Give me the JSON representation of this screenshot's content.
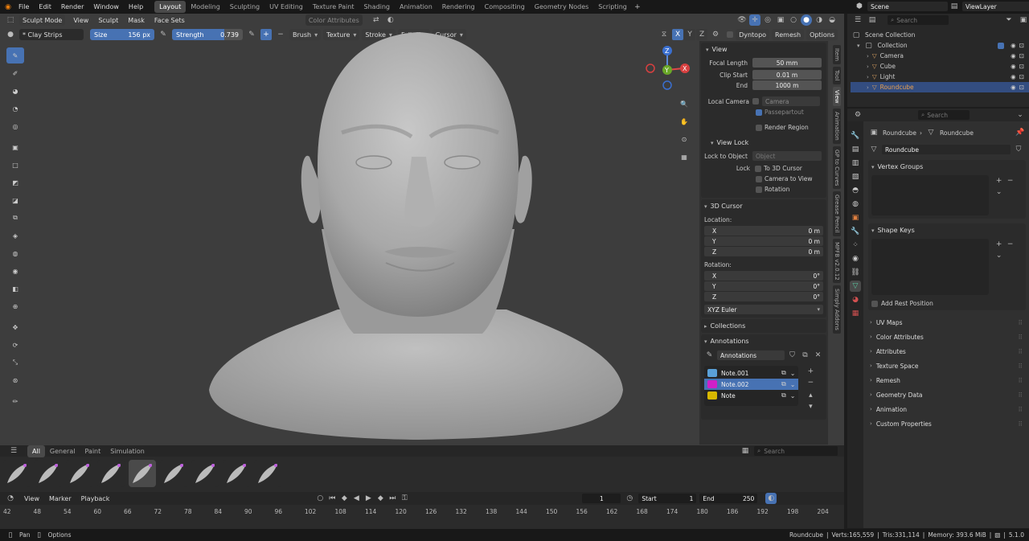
{
  "topbar": {
    "menus": [
      "File",
      "Edit",
      "Render",
      "Window",
      "Help"
    ],
    "workspaces": [
      "Layout",
      "Modeling",
      "Sculpting",
      "UV Editing",
      "Texture Paint",
      "Shading",
      "Animation",
      "Rendering",
      "Compositing",
      "Geometry Nodes",
      "Scripting"
    ],
    "active_workspace": "Layout",
    "scene": "Scene",
    "view_layer": "ViewLayer"
  },
  "viewport_header": {
    "mode": "Sculpt Mode",
    "menus": [
      "View",
      "Sculpt",
      "Mask",
      "Face Sets"
    ],
    "color_attributes": "Color Attributes"
  },
  "tool_header": {
    "brush": "* Clay Strips",
    "size_label": "Size",
    "size_value": "156 px",
    "strength_label": "Strength",
    "strength_value": "0.739",
    "strength_fraction": 0.739,
    "dropdowns": [
      "Brush",
      "Texture",
      "Stroke",
      "Falloff",
      "Cursor"
    ],
    "axes": [
      "X",
      "Y",
      "Z"
    ],
    "dyntopo": "Dyntopo",
    "remesh": "Remesh",
    "options": "Options"
  },
  "n_panel": {
    "tabs": [
      "Item",
      "Tool",
      "View",
      "Animation",
      "GP to Curves",
      "Grease Pencil",
      "MPFB v2.0.12",
      "Simply Addons"
    ],
    "active_tab": "View",
    "view": {
      "title": "View",
      "focal_length_label": "Focal Length",
      "focal_length": "50 mm",
      "clip_start_label": "Clip Start",
      "clip_start": "0.01 m",
      "end_label": "End",
      "end": "1000 m",
      "local_camera_label": "Local Camera",
      "camera_placeholder": "Camera",
      "passepartout": "Passepartout",
      "render_region": "Render Region"
    },
    "view_lock": {
      "title": "View Lock",
      "lock_to_object_label": "Lock to Object",
      "object_placeholder": "Object",
      "lock_label": "Lock",
      "to_3d_cursor": "To 3D Cursor",
      "camera_to_view": "Camera to View",
      "rotation": "Rotation"
    },
    "cursor": {
      "title": "3D Cursor",
      "location_label": "Location:",
      "rotation_label": "Rotation:",
      "loc": [
        {
          "axis": "X",
          "value": "0 m"
        },
        {
          "axis": "Y",
          "value": "0 m"
        },
        {
          "axis": "Z",
          "value": "0 m"
        }
      ],
      "rot": [
        {
          "axis": "X",
          "value": "0°"
        },
        {
          "axis": "Y",
          "value": "0°"
        },
        {
          "axis": "Z",
          "value": "0°"
        }
      ],
      "mode": "XYZ Euler"
    },
    "collections": "Collections",
    "annotations": {
      "title": "Annotations",
      "name": "Annotations",
      "notes": [
        {
          "name": "Note.001",
          "color": "#5aa0d8",
          "selected": false
        },
        {
          "name": "Note.002",
          "color": "#d020c8",
          "selected": true
        },
        {
          "name": "Note",
          "color": "#d8b800",
          "selected": false
        }
      ]
    }
  },
  "outliner": {
    "search_placeholder": "Search",
    "scene_collection": "Scene Collection",
    "collection": "Collection",
    "items": [
      {
        "name": "Camera",
        "icon": "camera-icon",
        "color": "#d8a060"
      },
      {
        "name": "Cube",
        "icon": "mesh-icon",
        "color": "#d8a060"
      },
      {
        "name": "Light",
        "icon": "light-icon",
        "color": "#d8a060"
      },
      {
        "name": "Roundcube",
        "icon": "mesh-icon",
        "color": "#d8a060",
        "selected": true
      }
    ]
  },
  "properties": {
    "search_placeholder": "Search",
    "breadcrumb_object": "Roundcube",
    "breadcrumb_data": "Roundcube",
    "mesh_name": "Roundcube",
    "vertex_groups": "Vertex Groups",
    "shape_keys": "Shape Keys",
    "add_rest_position": "Add Rest Position",
    "collapsed": [
      "UV Maps",
      "Color Attributes",
      "Attributes",
      "Texture Space",
      "Remesh",
      "Geometry Data",
      "Animation",
      "Custom Properties"
    ]
  },
  "asset_shelf": {
    "tabs": [
      "All",
      "General",
      "Paint",
      "Simulation"
    ],
    "active_tab": "All",
    "search_placeholder": "Search",
    "brush_count": 9
  },
  "timeline": {
    "menus": [
      "View",
      "Marker",
      "Playback"
    ],
    "current_frame": "1",
    "start_label": "Start",
    "start": "1",
    "end_label": "End",
    "end": "250",
    "ticks": [
      "42",
      "48",
      "54",
      "60",
      "66",
      "72",
      "78",
      "84",
      "90",
      "96",
      "102",
      "108",
      "114",
      "120",
      "126",
      "132",
      "138",
      "144",
      "150",
      "156",
      "162",
      "168",
      "174",
      "180",
      "186",
      "192",
      "198",
      "204"
    ]
  },
  "statusbar": {
    "pan": "Pan",
    "options": "Options",
    "object": "Roundcube",
    "verts": "Verts:165,559",
    "tris": "Tris:331,114",
    "memory": "Memory: 393.6 MiB",
    "version": "5.1.0"
  },
  "colors": {
    "accent": "#4772b3",
    "viewport_bg": "#3d3d3d",
    "panel_bg": "#303030"
  }
}
